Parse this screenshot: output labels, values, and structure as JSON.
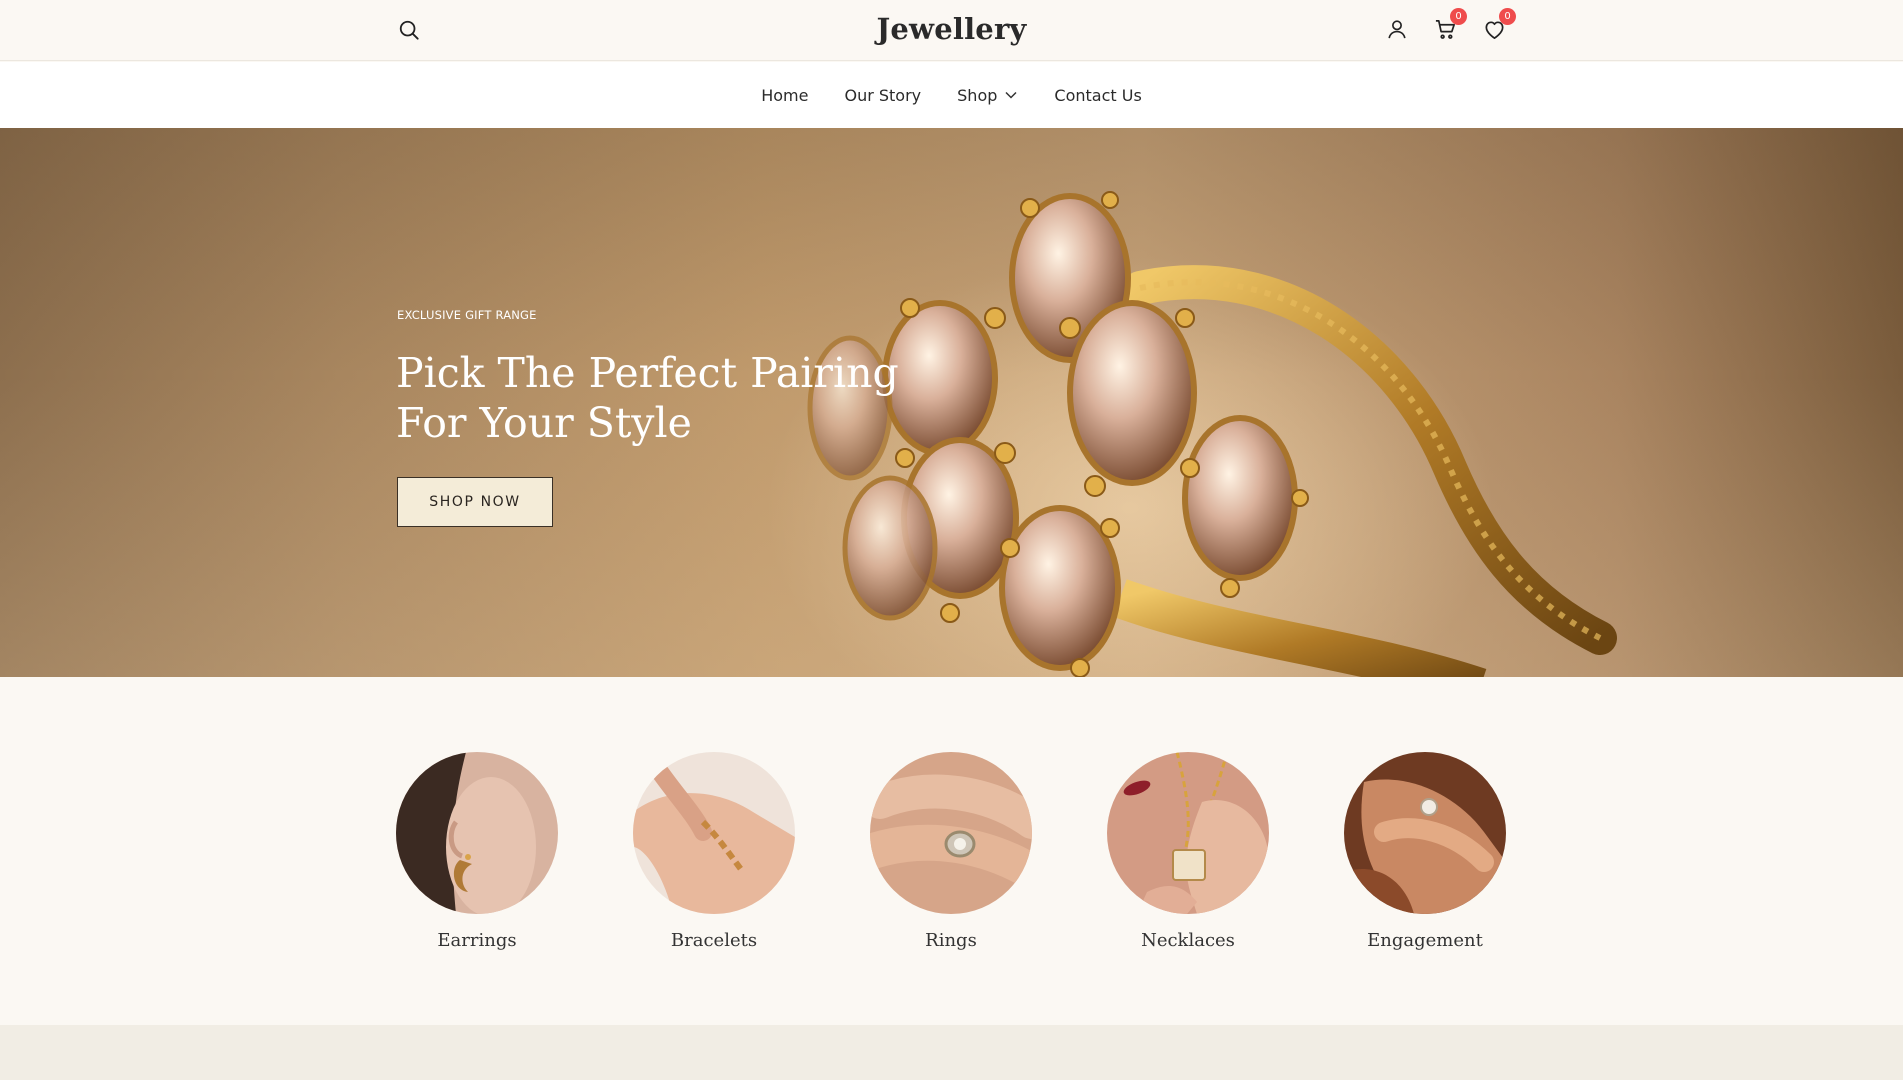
{
  "header": {
    "logo": "Jewellery",
    "cart_count": "0",
    "wishlist_count": "0",
    "icons": [
      "search-icon",
      "user-icon",
      "cart-icon",
      "heart-icon"
    ]
  },
  "nav": {
    "items": [
      {
        "label": "Home"
      },
      {
        "label": "Our Story"
      },
      {
        "label": "Shop"
      },
      {
        "label": "Contact Us"
      }
    ]
  },
  "hero": {
    "eyebrow": "EXCLUSIVE GIFT RANGE",
    "title": "Pick The Perfect Pairing\nFor Your Style",
    "cta": "SHOP NOW"
  },
  "categories": [
    {
      "label": "Earrings"
    },
    {
      "label": "Bracelets"
    },
    {
      "label": "Rings"
    },
    {
      "label": "Necklaces"
    },
    {
      "label": "Engagement"
    }
  ],
  "colors": {
    "background": "#fbf8f3",
    "badge": "#ef4c4c",
    "button_bg": "#f4ecd8",
    "hero_tone": "#c09a6c"
  }
}
